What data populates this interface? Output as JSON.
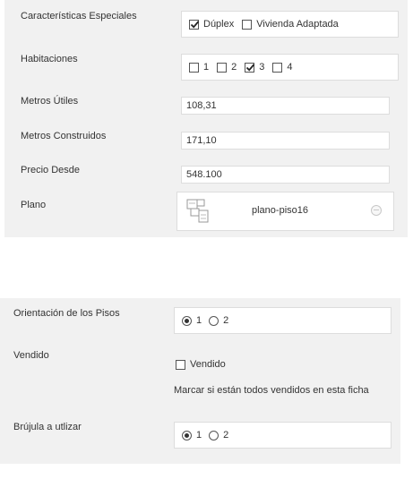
{
  "section1": {
    "caracteristicas": {
      "label": "Características Especiales",
      "options": [
        {
          "label": "Dúplex",
          "checked": true
        },
        {
          "label": "Vivienda Adaptada",
          "checked": false
        }
      ]
    },
    "habitaciones": {
      "label": "Habitaciones",
      "options": [
        {
          "label": "1",
          "checked": false
        },
        {
          "label": "2",
          "checked": false
        },
        {
          "label": "3",
          "checked": true
        },
        {
          "label": "4",
          "checked": false
        }
      ]
    },
    "metros_utiles": {
      "label": "Metros Útiles",
      "value": "108,31"
    },
    "metros_construidos": {
      "label": "Metros Construidos",
      "value": "171,10"
    },
    "precio_desde": {
      "label": "Precio Desde",
      "value": "548.100"
    },
    "plano": {
      "label": "Plano",
      "file_name": "plano-piso16",
      "file_icon": "floorplan-thumbnail",
      "remove_icon": "remove-icon"
    }
  },
  "section2": {
    "orientacion": {
      "label": "Orientación de los Pisos",
      "options": [
        {
          "label": "1",
          "selected": true
        },
        {
          "label": "2",
          "selected": false
        }
      ]
    },
    "vendido": {
      "label": "Vendido",
      "checkbox_label": "Vendido",
      "checked": false,
      "description": "Marcar si están todos vendidos en esta ficha"
    },
    "brujula": {
      "label": "Brújula a utlizar",
      "options": [
        {
          "label": "1",
          "selected": true
        },
        {
          "label": "2",
          "selected": false
        }
      ]
    }
  }
}
